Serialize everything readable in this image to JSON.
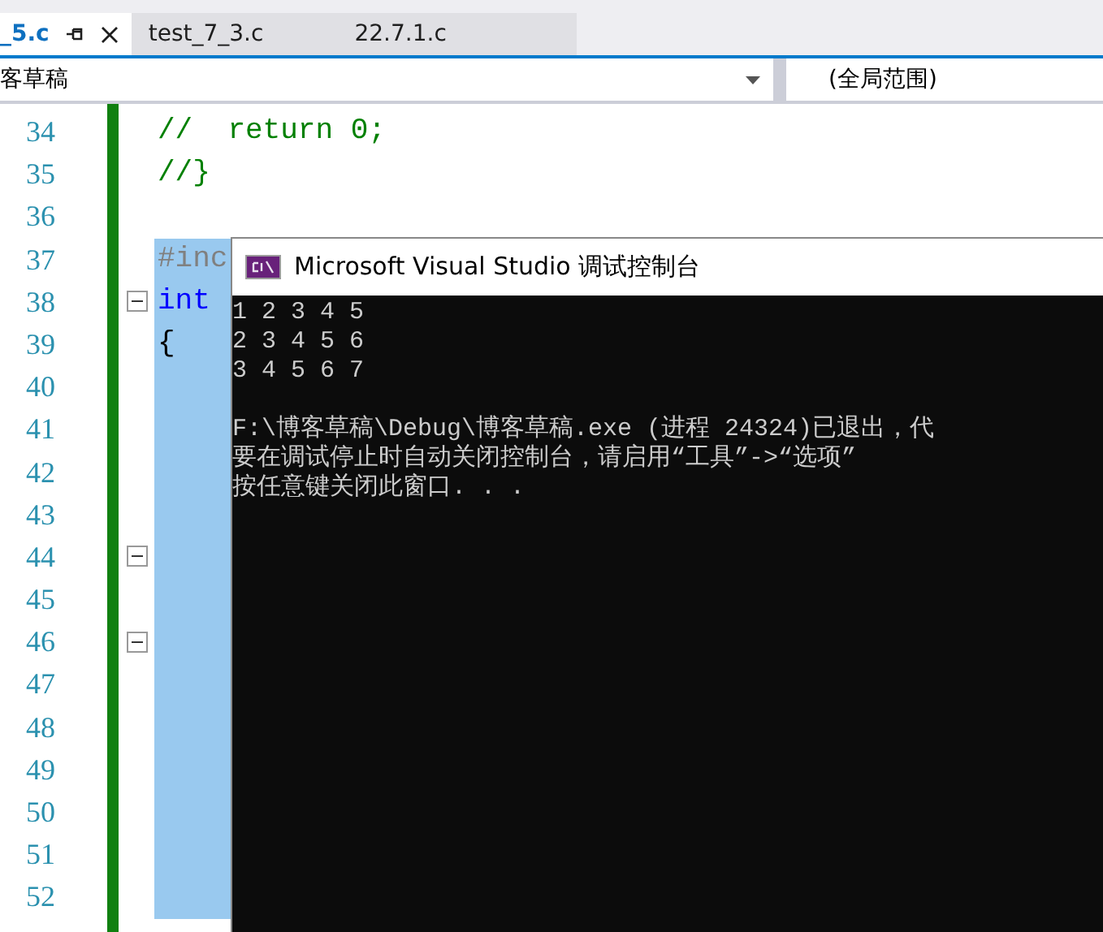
{
  "tabs": [
    {
      "label": "_5.c",
      "selected": true
    },
    {
      "label": "test_7_3.c",
      "selected": false
    },
    {
      "label": "22.7.1.c",
      "selected": false
    }
  ],
  "navigation_bar": {
    "project": "客草稿",
    "scope": "(全局范围)"
  },
  "editor": {
    "lines": [
      {
        "number": "34",
        "code": "//  return 0;",
        "kind": "comment",
        "selected": false,
        "foldable": false
      },
      {
        "number": "35",
        "code": "//}",
        "kind": "comment",
        "selected": false,
        "foldable": false
      },
      {
        "number": "36",
        "selected": false,
        "foldable": false
      },
      {
        "number": "37",
        "code": "#inc",
        "kind": "preprocessor",
        "selected": true,
        "foldable": false
      },
      {
        "number": "38",
        "code": "int",
        "kind": "keyword",
        "selected": true,
        "foldable": true
      },
      {
        "number": "39",
        "code": "{",
        "kind": "plain",
        "selected": true,
        "foldable": false
      },
      {
        "number": "40",
        "selected": true,
        "foldable": false
      },
      {
        "number": "41",
        "selected": true,
        "foldable": false
      },
      {
        "number": "42",
        "selected": true,
        "foldable": false
      },
      {
        "number": "43",
        "selected": true,
        "foldable": false
      },
      {
        "number": "44",
        "selected": true,
        "foldable": true
      },
      {
        "number": "45",
        "selected": true,
        "foldable": false
      },
      {
        "number": "46",
        "selected": true,
        "foldable": true
      },
      {
        "number": "47",
        "selected": true,
        "foldable": false
      },
      {
        "number": "48",
        "selected": true,
        "foldable": false
      },
      {
        "number": "49",
        "selected": true,
        "foldable": false
      },
      {
        "number": "50",
        "selected": true,
        "foldable": false
      },
      {
        "number": "51",
        "selected": true,
        "foldable": false
      },
      {
        "number": "52",
        "selected": true,
        "foldable": false
      }
    ]
  },
  "console": {
    "title": "Microsoft Visual Studio 调试控制台",
    "output": [
      "1 2 3 4 5",
      "2 3 4 5 6",
      "3 4 5 6 7"
    ],
    "messages": [
      "F:\\博客草稿\\Debug\\博客草稿.exe (进程 24324)已退出，代",
      "要在调试停止时自动关闭控制台，请启用“工具”->“选项”",
      "按任意键关闭此窗口. . ."
    ]
  }
}
